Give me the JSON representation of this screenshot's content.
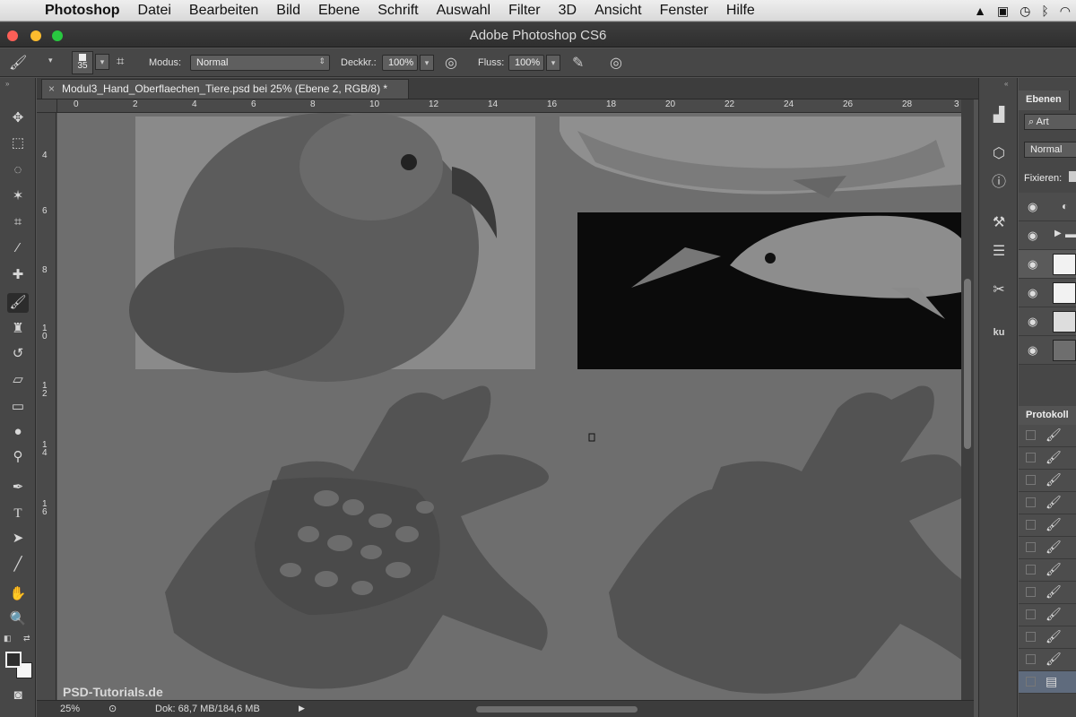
{
  "menubar": {
    "app_name": "Photoshop",
    "items": [
      "Datei",
      "Bearbeiten",
      "Bild",
      "Ebene",
      "Schrift",
      "Auswahl",
      "Filter",
      "3D",
      "Ansicht",
      "Fenster",
      "Hilfe"
    ]
  },
  "window": {
    "title": "Adobe Photoshop CS6"
  },
  "options": {
    "brush_size": "35",
    "mode_label": "Modus:",
    "mode_value": "Normal",
    "opacity_label": "Deckkr.:",
    "opacity_value": "100%",
    "flow_label": "Fluss:",
    "flow_value": "100%"
  },
  "document": {
    "tab_title": "Modul3_Hand_Oberflaechen_Tiere.psd bei 25% (Ebene 2, RGB/8) *"
  },
  "ruler": {
    "h_ticks": [
      "0",
      "2",
      "4",
      "6",
      "8",
      "10",
      "12",
      "14",
      "16",
      "18",
      "20",
      "22",
      "24",
      "26",
      "28",
      "3"
    ],
    "v_ticks": [
      "4",
      "6",
      "8",
      "1\n0",
      "1\n2",
      "1\n4",
      "1\n6"
    ]
  },
  "status": {
    "zoom": "25%",
    "doc_info": "Dok: 68,7 MB/184,6 MB"
  },
  "panels": {
    "layers_tab": "Ebenen",
    "filter_label": "Art",
    "blend_mode": "Normal",
    "lock_label": "Fixieren:",
    "history_tab": "Protokoll"
  },
  "watermark": "PSD-Tutorials.de"
}
